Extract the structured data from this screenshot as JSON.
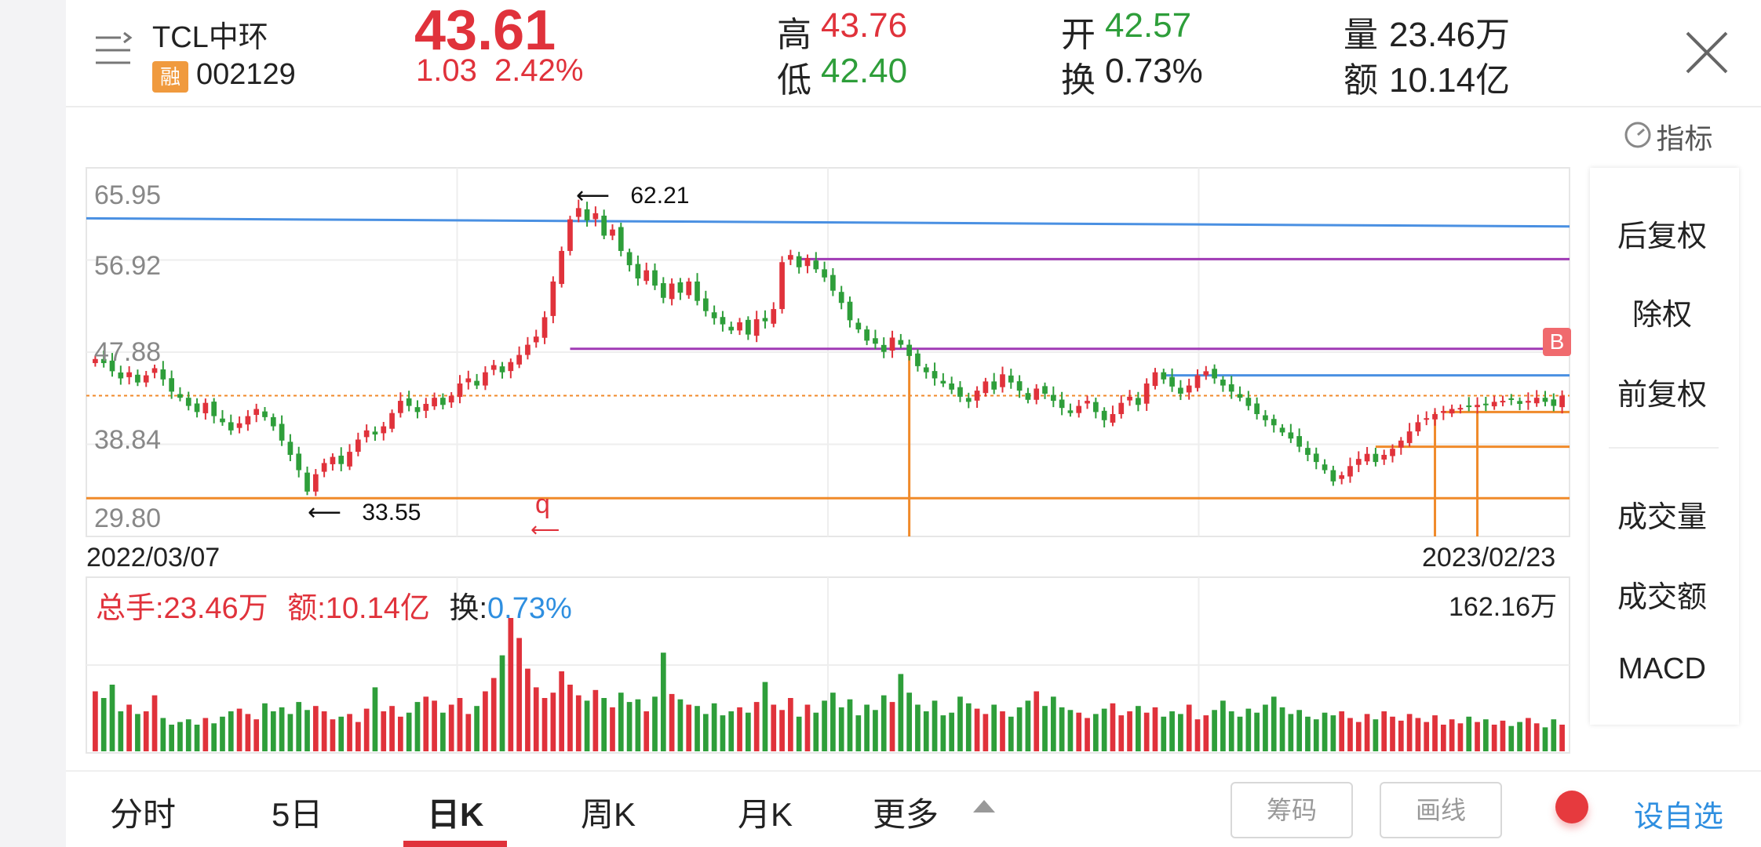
{
  "header": {
    "stock_name": "TCL中环",
    "badge": "融",
    "stock_code": "002129",
    "price": "43.61",
    "change": "1.03",
    "change_pct": "2.42%",
    "high_label": "高",
    "high_value": "43.76",
    "low_label": "低",
    "low_value": "42.40",
    "open_label": "开",
    "open_value": "42.57",
    "turnover_label": "换",
    "turnover_value": "0.73%",
    "volume_label": "量",
    "volume_value": "23.46万",
    "amount_label": "额",
    "amount_value": "10.14亿"
  },
  "indicator_label": "指标",
  "chart": {
    "y_ticks": [
      "65.95",
      "56.92",
      "47.88",
      "38.84",
      "29.80"
    ],
    "start_date": "2022/03/07",
    "end_date": "2023/02/23",
    "high_annotation": "62.21",
    "low_annotation": "33.55",
    "marker_b": "B",
    "marker_q": "q"
  },
  "volume_panel": {
    "total_label": "总手:23.46万",
    "amount_label": "额:10.14亿",
    "turnover_label": "换:",
    "turnover_value": "0.73%",
    "max_label": "162.16万"
  },
  "side_menu": [
    "后复权",
    "除权",
    "前复权",
    "成交量",
    "成交额",
    "MACD"
  ],
  "tabs": [
    "分时",
    "5日",
    "日K",
    "周K",
    "月K",
    "更多"
  ],
  "buttons": {
    "chips": "筹码",
    "draw": "画线",
    "add_watch": "设自选"
  },
  "colors": {
    "up": "#e0323b",
    "down": "#2e9e3a",
    "accent": "#2f8fe0"
  },
  "chart_data": {
    "type": "candlestick",
    "ylim": [
      29.8,
      65.95
    ],
    "close": [
      47.2,
      46.8,
      46.0,
      45.3,
      45.9,
      44.9,
      45.6,
      46.3,
      45.2,
      44.0,
      43.4,
      42.6,
      42.0,
      42.9,
      41.6,
      41.0,
      40.2,
      40.9,
      41.6,
      42.3,
      41.5,
      40.6,
      39.2,
      37.8,
      36.3,
      34.2,
      35.9,
      37.0,
      37.6,
      36.9,
      38.1,
      39.3,
      40.2,
      39.8,
      40.6,
      41.9,
      43.1,
      42.6,
      42.0,
      42.8,
      43.4,
      42.7,
      43.6,
      44.8,
      45.3,
      44.6,
      45.9,
      46.6,
      45.9,
      46.9,
      47.6,
      48.6,
      49.4,
      51.3,
      54.8,
      57.8,
      60.9,
      62.0,
      60.8,
      61.5,
      59.3,
      59.9,
      57.8,
      56.4,
      55.1,
      55.9,
      54.4,
      53.2,
      54.6,
      53.7,
      54.8,
      52.9,
      51.9,
      51.2,
      50.6,
      50.0,
      50.8,
      49.6,
      51.1,
      50.9,
      52.1,
      56.7,
      57.4,
      56.2,
      57.1,
      56.0,
      55.2,
      53.9,
      52.7,
      51.0,
      50.1,
      49.0,
      48.7,
      47.9,
      49.3,
      48.6,
      47.5,
      46.5,
      45.9,
      45.3,
      44.8,
      44.2,
      43.5,
      43.0,
      44.1,
      45.0,
      44.2,
      45.7,
      44.9,
      44.1,
      43.2,
      44.3,
      43.8,
      43.1,
      42.4,
      41.9,
      42.6,
      43.1,
      42.0,
      41.2,
      41.8,
      42.9,
      43.5,
      42.7,
      44.8,
      45.9,
      45.2,
      44.5,
      43.8,
      44.6,
      45.6,
      46.0,
      45.3,
      44.6,
      44.0,
      43.4,
      42.6,
      41.8,
      41.2,
      40.7,
      40.0,
      39.4,
      38.6,
      37.8,
      37.1,
      36.3,
      35.2,
      35.8,
      36.7,
      37.4,
      37.9,
      37.1,
      37.8,
      38.4,
      39.2,
      40.1,
      41.0,
      41.4,
      41.8,
      42.1,
      42.3,
      42.4,
      42.6,
      42.7,
      42.8,
      43.0,
      43.1,
      43.2,
      42.8,
      43.1,
      43.4,
      43.0,
      42.6,
      43.61
    ],
    "volume_relative": [
      0.45,
      0.4,
      0.5,
      0.3,
      0.35,
      0.28,
      0.3,
      0.42,
      0.25,
      0.2,
      0.22,
      0.24,
      0.2,
      0.25,
      0.21,
      0.26,
      0.3,
      0.32,
      0.28,
      0.24,
      0.36,
      0.3,
      0.33,
      0.28,
      0.37,
      0.31,
      0.34,
      0.3,
      0.24,
      0.26,
      0.28,
      0.22,
      0.32,
      0.48,
      0.3,
      0.34,
      0.26,
      0.29,
      0.37,
      0.41,
      0.38,
      0.29,
      0.35,
      0.4,
      0.28,
      0.34,
      0.45,
      0.55,
      0.72,
      1.0,
      0.85,
      0.62,
      0.48,
      0.4,
      0.44,
      0.6,
      0.5,
      0.42,
      0.38,
      0.46,
      0.4,
      0.33,
      0.44,
      0.37,
      0.39,
      0.3,
      0.41,
      0.74,
      0.43,
      0.39,
      0.35,
      0.34,
      0.28,
      0.36,
      0.27,
      0.3,
      0.33,
      0.29,
      0.37,
      0.52,
      0.35,
      0.31,
      0.4,
      0.26,
      0.35,
      0.29,
      0.38,
      0.44,
      0.33,
      0.39,
      0.27,
      0.35,
      0.31,
      0.42,
      0.37,
      0.58,
      0.44,
      0.35,
      0.3,
      0.38,
      0.27,
      0.29,
      0.41,
      0.36,
      0.32,
      0.28,
      0.35,
      0.3,
      0.26,
      0.33,
      0.38,
      0.45,
      0.34,
      0.41,
      0.33,
      0.31,
      0.29,
      0.25,
      0.28,
      0.32,
      0.36,
      0.27,
      0.3,
      0.34,
      0.29,
      0.33,
      0.26,
      0.3,
      0.28,
      0.35,
      0.24,
      0.27,
      0.31,
      0.38,
      0.3,
      0.26,
      0.32,
      0.29,
      0.35,
      0.41,
      0.33,
      0.28,
      0.31,
      0.26,
      0.24,
      0.29,
      0.27,
      0.3,
      0.25,
      0.22,
      0.28,
      0.24,
      0.3,
      0.26,
      0.23,
      0.28,
      0.25,
      0.22,
      0.27,
      0.2,
      0.24,
      0.21,
      0.26,
      0.22,
      0.24,
      0.2,
      0.23,
      0.19,
      0.22,
      0.25,
      0.21,
      0.18,
      0.24,
      0.2,
      0.17,
      0.22,
      0.16
    ]
  }
}
